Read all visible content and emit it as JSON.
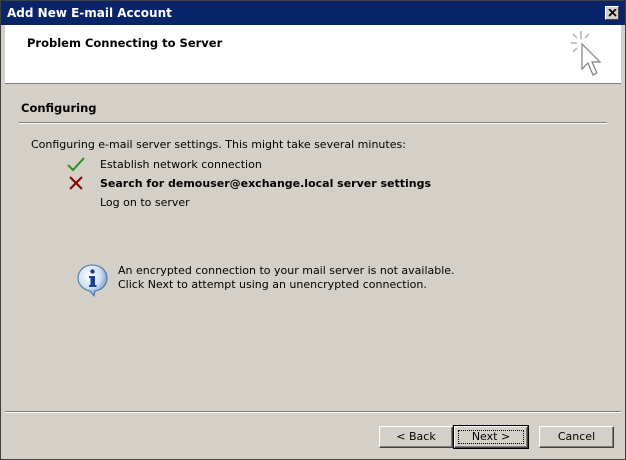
{
  "window": {
    "title": "Add New E-mail Account"
  },
  "header": {
    "title": "Problem Connecting to Server",
    "icon": "cursor-click-icon"
  },
  "section": {
    "title": "Configuring",
    "intro": "Configuring e-mail server settings. This might take several minutes:"
  },
  "steps": [
    {
      "label": "Establish network connection",
      "status": "success",
      "icon": "check-icon",
      "color": "#2e8b2e"
    },
    {
      "label": "Search for demouser@exchange.local server settings",
      "status": "failed",
      "icon": "x-icon",
      "color": "#8b0000"
    },
    {
      "label": "Log on to server",
      "status": "pending",
      "icon": ""
    }
  ],
  "info": {
    "icon": "info-icon",
    "line1": "An encrypted connection to your mail server is not available.",
    "line2": "Click Next to attempt using an unencrypted connection."
  },
  "buttons": {
    "back": "< Back",
    "next": "Next >",
    "cancel": "Cancel"
  },
  "colors": {
    "titlebar": "#0a246a",
    "dialog_bg": "#d4d0c8"
  }
}
